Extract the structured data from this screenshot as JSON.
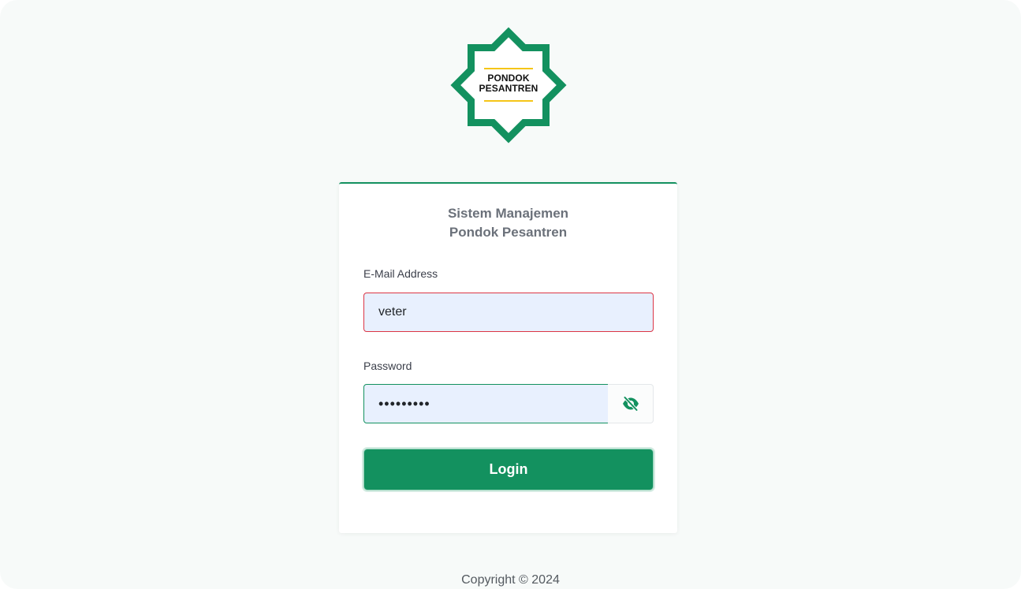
{
  "logo": {
    "line1": "PONDOK",
    "line2": "PESANTREN",
    "colors": {
      "star": "#13915f",
      "accent": "#f5c518"
    }
  },
  "card": {
    "title_line1": "Sistem Manajemen",
    "title_line2": "Pondok Pesantren"
  },
  "form": {
    "email": {
      "label": "E-Mail Address",
      "value": "veter"
    },
    "password": {
      "label": "Password",
      "value": "•••••••••",
      "toggle_icon": "eye-slash-icon"
    },
    "login_label": "Login"
  },
  "footer": {
    "copyright": "Copyright © 2024"
  },
  "colors": {
    "primary": "#13915f",
    "error_border": "#dc3545",
    "input_bg": "#e8f0fe"
  }
}
